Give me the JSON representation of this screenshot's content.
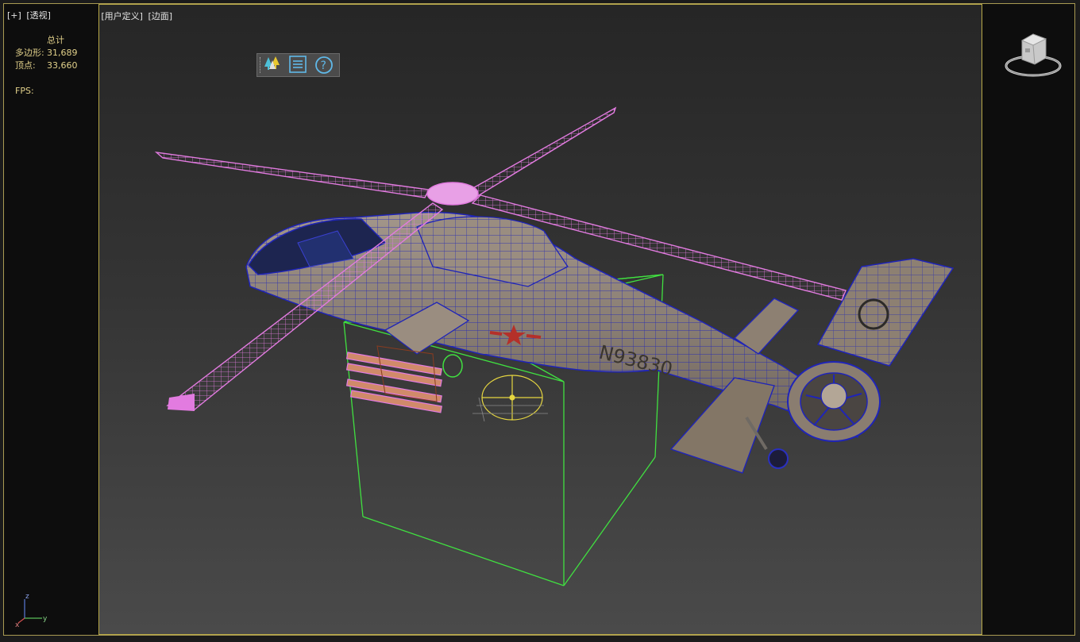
{
  "viewport": {
    "labels": [
      "[+]",
      "[透视]",
      "[用户定义]",
      "[边面]"
    ]
  },
  "stats": {
    "header": "总计",
    "polygons_label": "多边形:",
    "polygons_value": "31,689",
    "vertices_label": "顶点:",
    "vertices_value": "33,660",
    "fps_label": "FPS:"
  },
  "scene": {
    "tail_number": "N93830"
  },
  "axis": {
    "z": "z",
    "x": "x",
    "y": "y"
  },
  "colors": {
    "frame_border": "#b8a948",
    "stats_text": "#e1d08a",
    "rotor_wire": "#e27be0",
    "body_wire": "#1f24b8",
    "body_fill": "#8c7f70",
    "helper_box": "#40e040",
    "light_helper": "#e6d640"
  },
  "toolbar": {
    "icons": [
      "trees-icon",
      "list-icon",
      "help-icon"
    ]
  }
}
